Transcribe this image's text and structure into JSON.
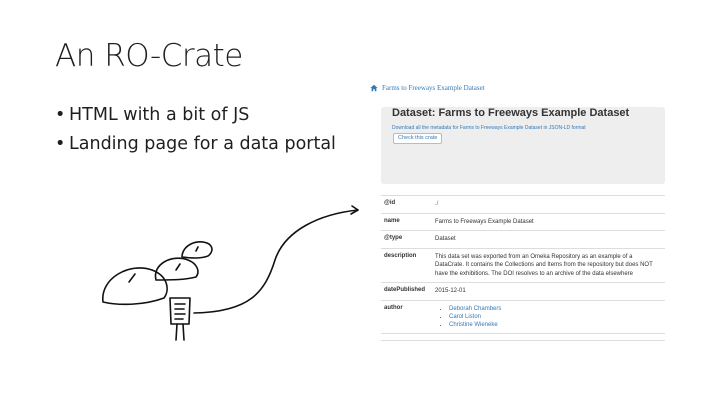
{
  "slide": {
    "title": "An RO-Crate",
    "bullets": [
      "HTML with a bit of JS",
      "Landing page for a data portal"
    ]
  },
  "screenshot": {
    "breadcrumb": {
      "home_icon": "home-icon",
      "label": "Farms   to   Freeways   Example   Dataset"
    },
    "jumbotron": {
      "title": "Dataset: Farms to Freeways Example Dataset",
      "download_link": "Download all the metadata for Farms to Freeways Example Dataset in JSON-LD format",
      "check_button": "Check this crate"
    },
    "table": {
      "id": {
        "key": "@id",
        "value": "./"
      },
      "name": {
        "key": "name",
        "value": "Farms to Freeways Example Dataset"
      },
      "type": {
        "key": "@type",
        "value": "Dataset"
      },
      "description": {
        "key": "description",
        "value": "This data set was exported from an Omeka Repository as an example of a DataCrate. It contains the Collections and Items from the repository but does NOT have the exhibitions. The DOI resolves to an archive of the data elsewhere"
      },
      "datePublished": {
        "key": "datePublished",
        "value": "2015-12-01"
      },
      "author": {
        "key": "author",
        "values": [
          "Deborah Chambers",
          "Carol Liston",
          "Christine Wieneke"
        ]
      }
    },
    "colors": {
      "link": "#337ab7",
      "jumbotron_bg": "#eeeeee"
    }
  }
}
